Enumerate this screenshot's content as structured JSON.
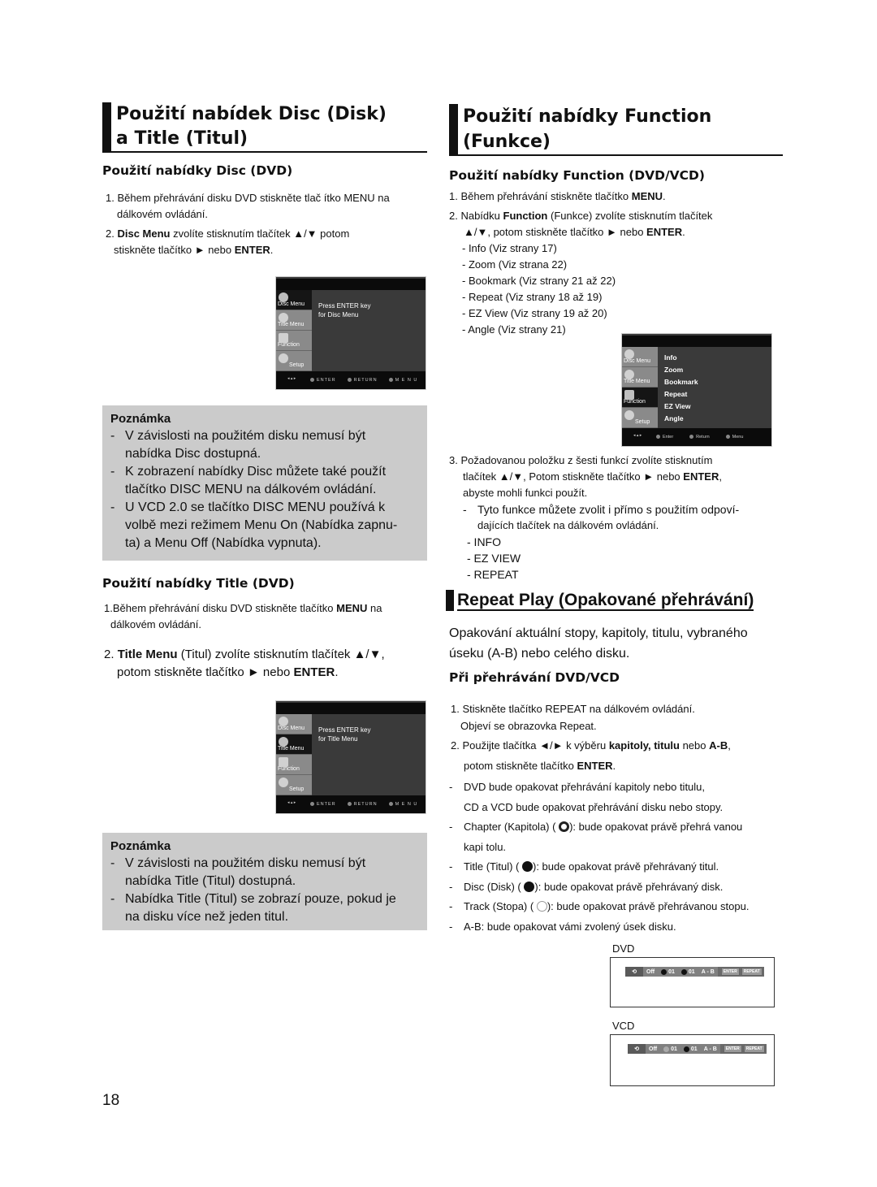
{
  "left": {
    "heading_line1": "Použití nabídek Disc (Disk)",
    "heading_line2": "a Title (Titul)",
    "disc_section": {
      "title": "Použití nabídky Disc (DVD)",
      "step1": "1. Během přehrávání disku DVD stiskněte tlač ítko MENU na",
      "step1_cont": "dálkovém ovládání.",
      "step2_pre": "2. ",
      "step2_bold": "Disc Menu",
      "step2_rest": " zvolíte stisknutím tlačítek ▲/▼ potom",
      "step2_cont_pre": "stiskněte tlačítko ► nebo ",
      "step2_cont_bold": "ENTER",
      "step2_end": ".",
      "screen": {
        "sidebar": [
          "Disc Menu",
          "Title Menu",
          "Function",
          "Setup"
        ],
        "active": "Disc Menu",
        "message_line1": "Press ENTER key",
        "message_line2": "for Disc Menu",
        "footer": [
          "ENTER",
          "RETURN",
          "M E N U"
        ]
      },
      "note": {
        "title": "Poznámka",
        "items": [
          [
            "V závislosti na použitém disku nemusí být",
            "nabídka Disc dostupná."
          ],
          [
            "K zobrazení nabídky Disc můžete také použít",
            "tlačítko DISC MENU na dálkovém ovládání."
          ],
          [
            "U VCD 2.0 se tlačítko DISC MENU používá k",
            "volbě mezi režimem Menu On (Nabídka zapnu-",
            "ta) a Menu Off (Nabídka vypnuta)."
          ]
        ]
      }
    },
    "title_section": {
      "title": "Použití nabídky Title (DVD)",
      "step1_pre": "1.Během přehrávání disku DVD stiskněte tlačítko ",
      "step1_bold": "MENU",
      "step1_end": " na",
      "step1_cont": "dálkovém ovládání.",
      "step2_pre": "2. ",
      "step2_bold": "Title Menu",
      "step2_rest": " (Titul) zvolíte stisknutím tlačítek ▲/▼,",
      "step2_cont_pre": "potom stiskněte tlačítko ► nebo ",
      "step2_cont_bold": "ENTER",
      "step2_end": ".",
      "screen": {
        "sidebar": [
          "Disc Menu",
          "Title Menu",
          "Function",
          "Setup"
        ],
        "active": "Title Menu",
        "message_line1": "Press ENTER key",
        "message_line2": "for Title Menu",
        "footer": [
          "ENTER",
          "RETURN",
          "M E N U"
        ]
      },
      "note": {
        "title": "Poznámka",
        "items": [
          [
            "V závislosti na použitém disku nemusí být",
            "nabídka Title (Titul) dostupná."
          ],
          [
            "Nabídka Title (Titul) se zobrazí pouze, pokud je",
            "na disku více než jeden titul."
          ]
        ]
      }
    }
  },
  "right": {
    "heading_line1": "Použití nabídky Function",
    "heading_line2": "(Funkce)",
    "function_section": {
      "title": "Použití nabídky Function (DVD/VCD)",
      "step1_pre": "1. Během přehrávání stiskněte tlačítko ",
      "step1_bold": "MENU",
      "step1_end": ".",
      "step2_pre": "2. Nabídku ",
      "step2_bold": "Function",
      "step2_rest": " (Funkce) zvolíte stisknutím tlačítek",
      "step2_cont_pre": "▲/▼, potom stiskněte tlačítko ► nebo ",
      "step2_cont_bold": "ENTER",
      "step2_end": ".",
      "options": [
        "- Info (Viz strany 17)",
        "- Zoom (Viz strana 22)",
        "- Bookmark (Viz strany 21 až 22)",
        "- Repeat (Viz strany 18 až 19)",
        "- EZ View (Viz strany 19 až 20)",
        "- Angle (Viz strany 21)"
      ],
      "screen": {
        "sidebar": [
          "Disc Menu",
          "Title Menu",
          "Function",
          "Setup"
        ],
        "active": "Function",
        "items": [
          "Info",
          "Zoom",
          "Bookmark",
          "Repeat",
          "EZ View",
          "Angle"
        ],
        "footer": [
          "Enter",
          "Return",
          "Menu"
        ]
      },
      "step3_line1": "3. Požadovanou položku z šesti funkcí zvolíte stisknutím",
      "step3_line2_pre": "tlačítek ▲/▼, Potom stiskněte tlačítko ► nebo ",
      "step3_line2_bold": "ENTER",
      "step3_line2_end": ",",
      "step3_line3": "abyste mohli funkci použít.",
      "direct_note_line1": "Tyto funkce můžete zvolit i přímo s použitím odpoví-",
      "direct_note_line2": "dajících tlačítek na dálkovém ovládání.",
      "direct_buttons": [
        "- INFO",
        "- EZ VIEW",
        "- REPEAT"
      ]
    },
    "repeat_section": {
      "heading": "Repeat Play (Opakované přehrávání)",
      "intro_line1": "Opakování aktuální stopy, kapitoly, titulu, vybraného",
      "intro_line2": "úseku (A-B) nebo celého disku.",
      "subtitle": "Při přehrávání DVD/VCD",
      "step1_line1": "1. Stiskněte tlačítko REPEAT na dálkovém ovládání.",
      "step1_line2": "Objeví se obrazovka Repeat.",
      "step2_pre": "2. Použijte tlačítka ◄/► k výběru ",
      "step2_bold": "kapitoly, titulu",
      "step2_mid": " nebo  ",
      "step2_bold2": "A-B",
      "step2_end": ",",
      "step2_cont_pre": "potom stiskněte tlačítko ",
      "step2_cont_bold": "ENTER",
      "step2_cont_end": ".",
      "bullets": [
        {
          "lines": [
            "DVD bude opakovat přehrávání kapitoly nebo titulu,",
            "CD a VCD bude opakovat přehrávání disku nebo  stopy."
          ]
        },
        {
          "pre": "Chapter (Kapitola) (",
          "icon": "chapter-repeat-icon",
          "post": "): bude opakovat právě přehrá vanou",
          "cont": "kapi tolu."
        },
        {
          "pre": "Title (Titul) (",
          "icon": "title-repeat-icon",
          "post": "): bude opakovat právě přehrávaný titul."
        },
        {
          "pre": "Disc (Disk) (",
          "icon": "disc-repeat-icon",
          "post": "): bude opakovat právě přehrávaný disk."
        },
        {
          "pre": "Track (Stopa) (",
          "icon": "track-repeat-icon",
          "post": "): bude opakovat právě přehrávanou stopu."
        },
        {
          "lines": [
            "A-B: bude opakovat vámi zvolený úsek disku."
          ]
        }
      ],
      "dvd_label": "DVD",
      "dvd_bar": {
        "mode": "Off",
        "chapter": "01",
        "title": "01",
        "ab": "A - B",
        "keys": [
          "ENTER",
          "REPEAT"
        ]
      },
      "vcd_label": "VCD",
      "vcd_bar": {
        "mode": "Off",
        "track": "01",
        "disc": "01",
        "ab": "A - B",
        "keys": [
          "ENTER",
          "REPEAT"
        ]
      }
    }
  },
  "page_number": "18"
}
